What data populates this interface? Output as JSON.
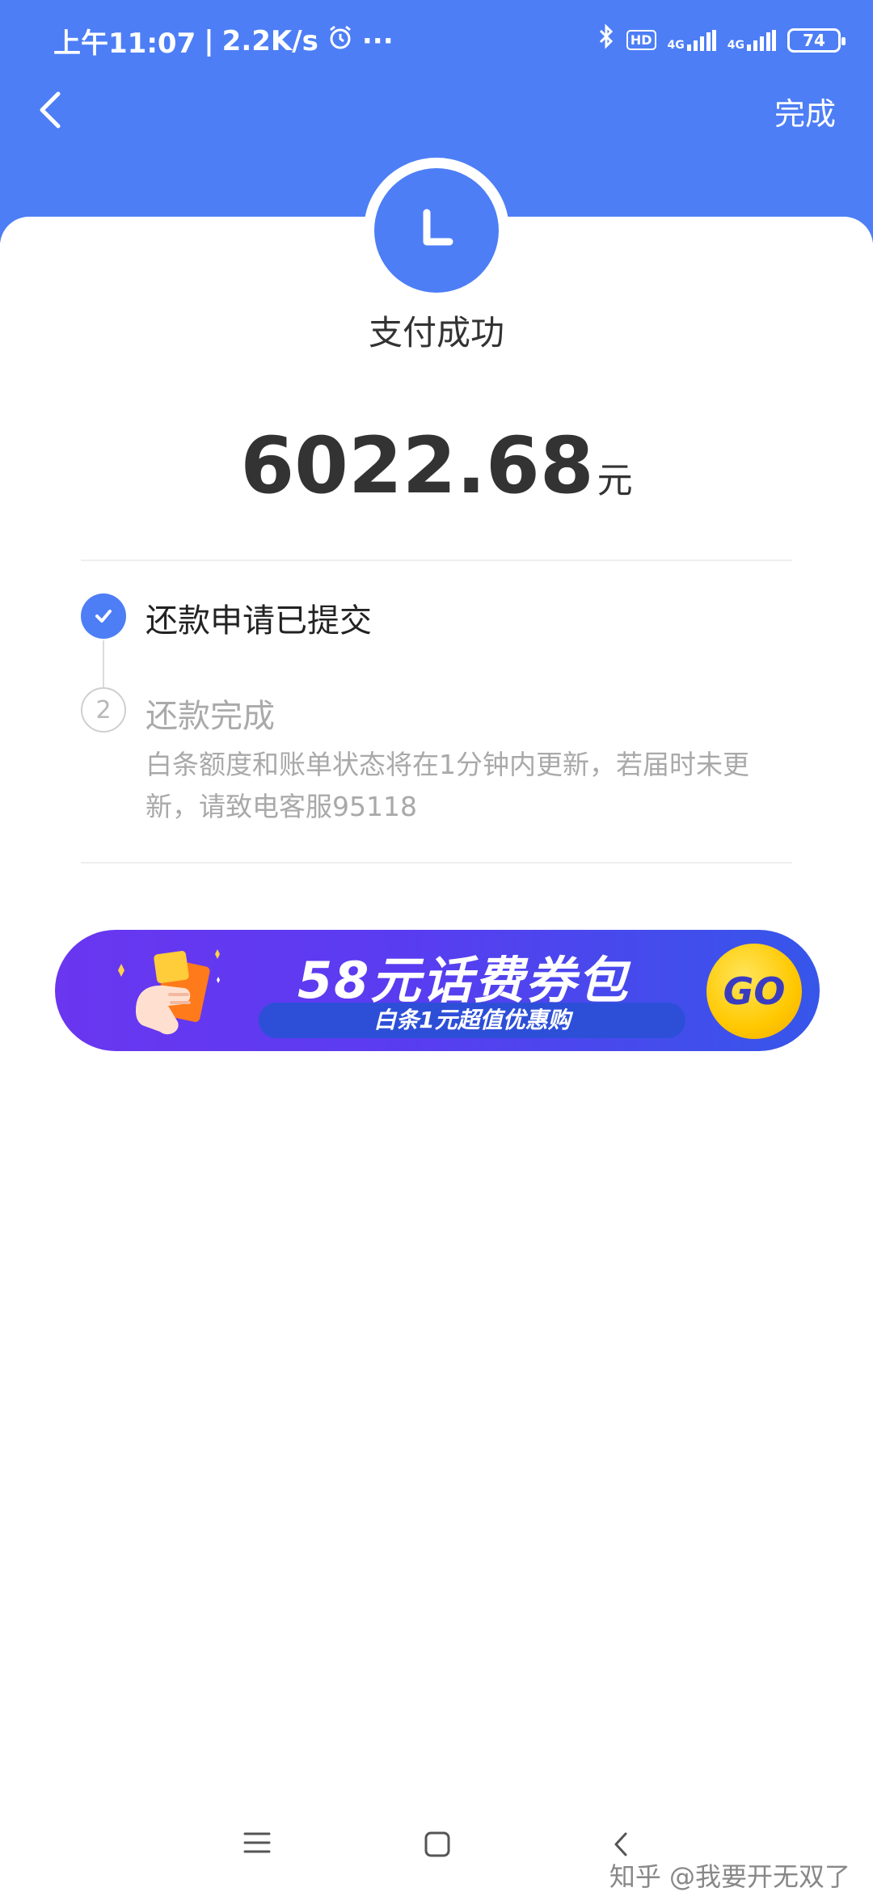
{
  "status_bar": {
    "time": "上午11:07",
    "network_speed": "2.2K/s",
    "more": "···",
    "hd": "HD",
    "sim1": "4G",
    "sim2": "4G",
    "battery": "74"
  },
  "nav": {
    "done_label": "完成"
  },
  "result": {
    "title": "支付成功",
    "amount": "6022.68",
    "unit": "元"
  },
  "steps": [
    {
      "number": "1",
      "label": "还款申请已提交",
      "status": "done"
    },
    {
      "number": "2",
      "label": "还款完成",
      "status": "pending",
      "description": "白条额度和账单状态将在1分钟内更新，若届时未更新，请致电客服95118"
    }
  ],
  "banner": {
    "title": "58元话费券包",
    "subtitle": "白条1元超值优惠购",
    "cta": "GO"
  },
  "colors": {
    "brand": "#4d7ef6",
    "banner_start": "#6a36f0",
    "banner_end": "#3656ea",
    "cta": "#ffc800"
  },
  "bottom_nav": {
    "menu_icon": "menu-icon",
    "home_icon": "home-icon",
    "back_icon": "back-icon"
  },
  "watermark": "知乎 @我要开无双了"
}
